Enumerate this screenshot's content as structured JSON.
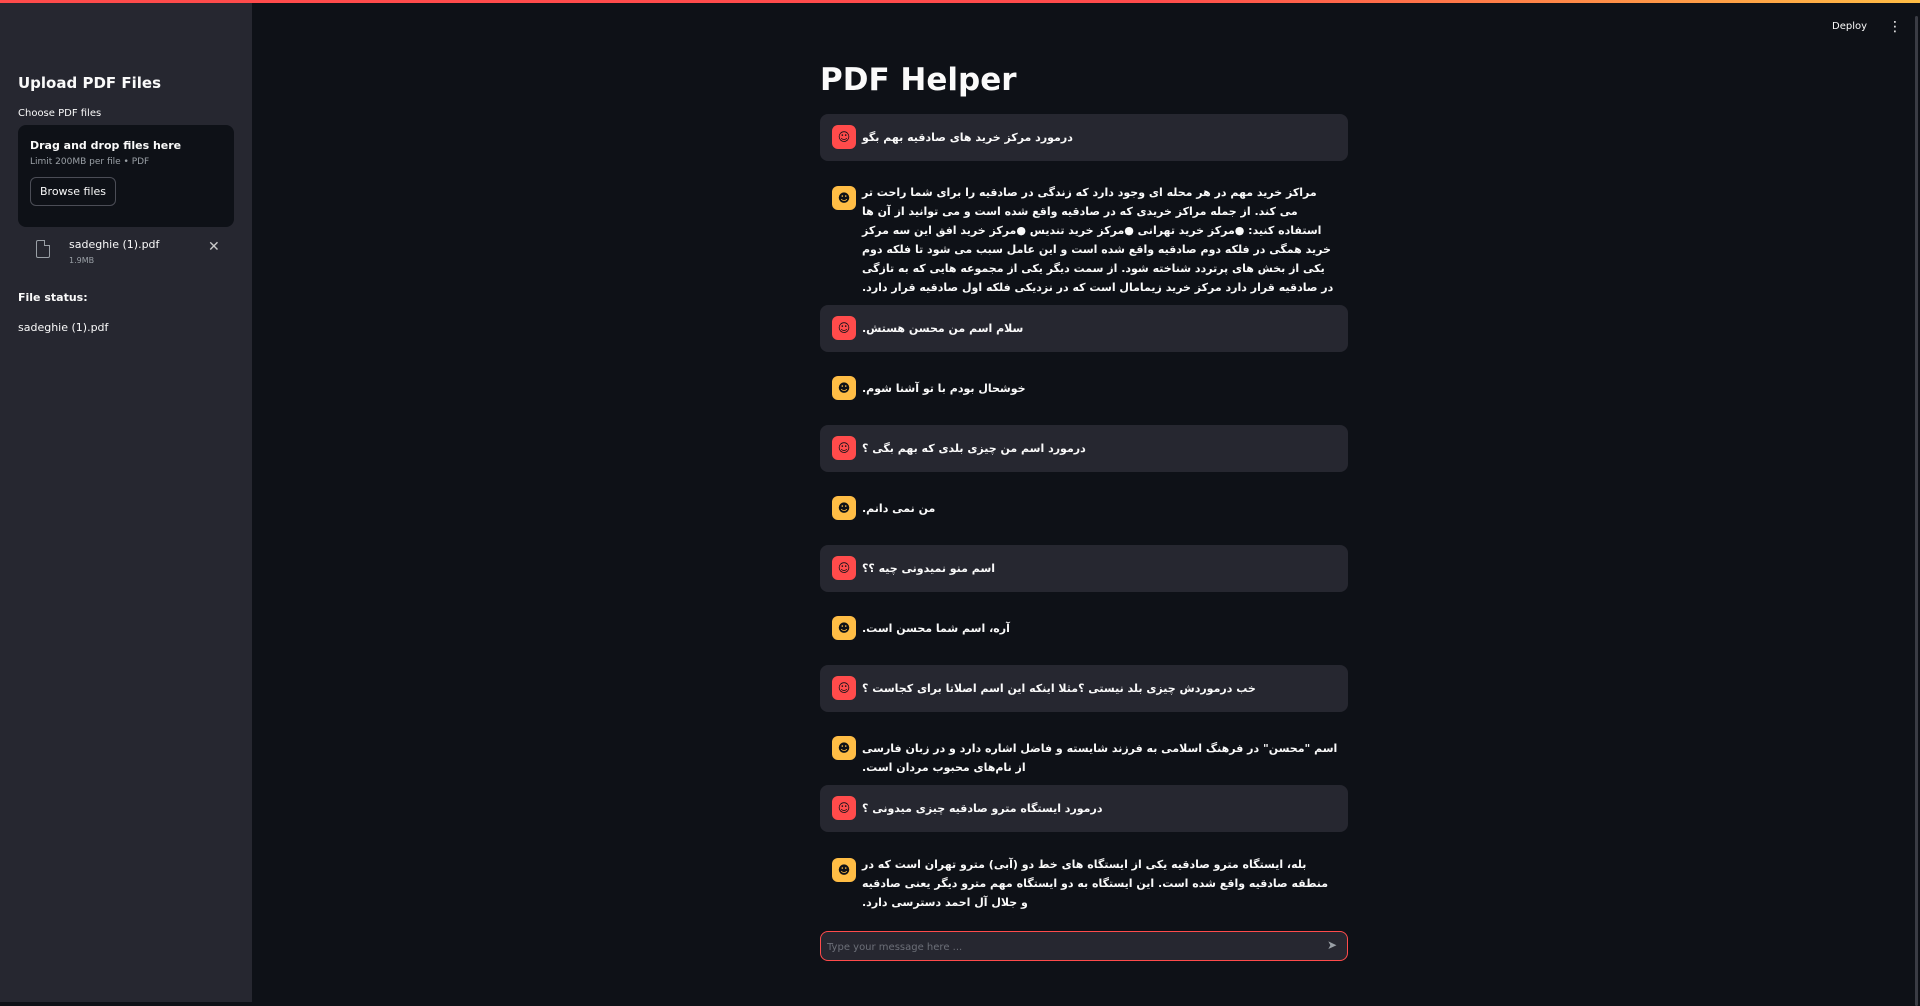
{
  "header": {
    "deploy_label": "Deploy",
    "menu_icon": "kebab-menu-icon"
  },
  "sidebar": {
    "title": "Upload PDF Files",
    "uploader_label": "Choose PDF files",
    "dropzone_text": "Drag and drop files here",
    "dropzone_limit": "Limit 200MB per file • PDF",
    "browse_label": "Browse files",
    "file": {
      "name": "sadeghie (1).pdf",
      "size": "1.9MB"
    },
    "status_title": "File status:",
    "status_value": "sadeghie (1).pdf"
  },
  "main": {
    "title": "PDF Helper"
  },
  "messages": [
    {
      "role": "user",
      "text": "درمورد مرکز خرید های صادقیه بهم بگو"
    },
    {
      "role": "assistant",
      "text": "مراکز خرید مهم در هر محله ای وجود دارد که زندگی در صادقیه را برای شما راحت تر می کند. از جمله مراکز خریدی که در صادقیه واقع شده است و می توانید از آن ها استفاده کنید: ●مرکز خرید تهرانی ●مرکز خرید تندیس ●مرکز خرید افق این سه مرکز خرید همگی در فلکه دوم صادقیه واقع شده است و این عامل سبب می شود تا فلکه دوم یکی از بخش های پرتردد شناخته شود. از سمت دیگر یکی از مجموعه هایی که به تازگی در صادقیه قرار دارد مرکز خرید زیمامال است که در نزدیکی فلکه اول صادقیه قرار دارد."
    },
    {
      "role": "user",
      "text": "سلام اسم من محسن هستش."
    },
    {
      "role": "assistant",
      "text": "خوشحال بودم با تو آشنا شوم."
    },
    {
      "role": "user",
      "text": "درمورد اسم من چیزی بلدی که بهم بگی ؟"
    },
    {
      "role": "assistant",
      "text": "من نمی دانم."
    },
    {
      "role": "user",
      "text": "اسم منو نمیدونی چیه ؟؟"
    },
    {
      "role": "assistant",
      "text": "آره، اسم شما محسن است."
    },
    {
      "role": "user",
      "text": "خب درموردش چیزی بلد نیستی ؟مثلا اینکه این اسم اصلاتا برای کجاست ؟"
    },
    {
      "role": "assistant",
      "text": "اسم \"محسن\" در فرهنگ اسلامی به فرزند شایسته و فاضل اشاره دارد و در زبان فارسی از نام‌های محبوب مردان است."
    },
    {
      "role": "user",
      "text": "درمورد ایستگاه مترو صادقیه چیزی میدونی ؟"
    },
    {
      "role": "assistant",
      "text": "بله، ایستگاه مترو صادقیه یکی از ایستگاه های خط دو (آبی) مترو تهران است که در منطقه صادقیه واقع شده است. این ایستگاه به دو ایستگاه مهم مترو دیگر یعنی صادقیه و جلال آل احمد دسترسی دارد."
    }
  ],
  "chat_input": {
    "placeholder": "Type your message here ...",
    "value": ""
  },
  "icons": {
    "user_avatar": "user-face-icon",
    "assistant_avatar": "robot-icon",
    "send": "send-arrow-icon",
    "file": "file-icon",
    "close": "close-icon"
  }
}
